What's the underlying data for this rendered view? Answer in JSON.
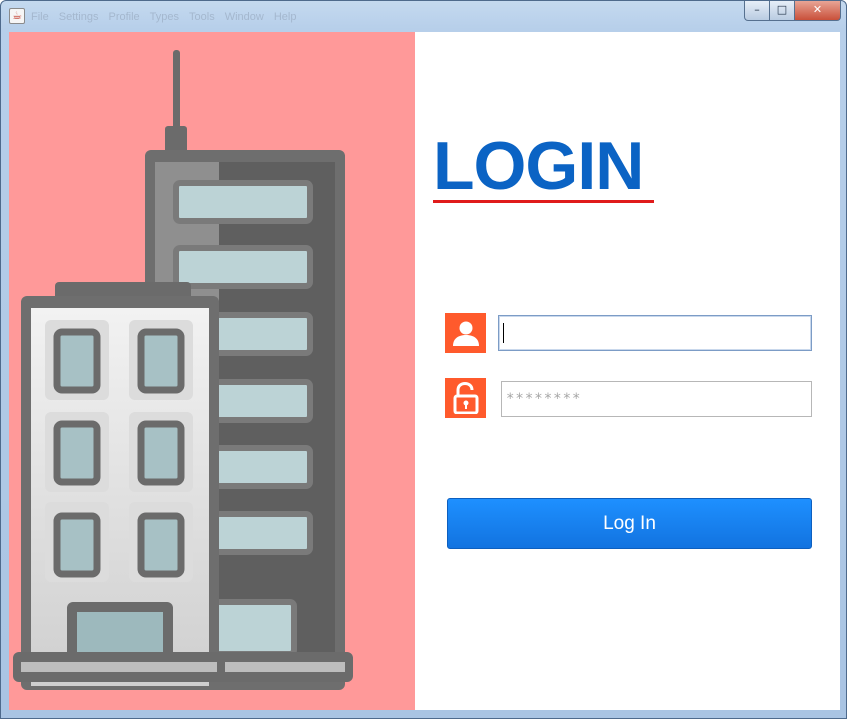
{
  "window": {
    "menu": [
      "File",
      "Settings",
      "Profile",
      "Types",
      "Tools",
      "Window",
      "Help"
    ],
    "controls": {
      "minimize": "–",
      "maximize": "□",
      "close": "✕"
    }
  },
  "colors": {
    "left_panel_bg": "#ff9999",
    "title_blue": "#0b63c4",
    "underline_red": "#e01b1b",
    "icon_orange": "#ff5a2c",
    "button_blue": "#1e90ff"
  },
  "icons": {
    "app": "java-cup-icon",
    "illustration": "office-buildings-illustration",
    "username": "user-icon",
    "password": "unlocked-padlock-icon"
  },
  "login": {
    "title": "LOGIN",
    "username_value": "",
    "password_value": "********",
    "button_label": "Log In"
  }
}
